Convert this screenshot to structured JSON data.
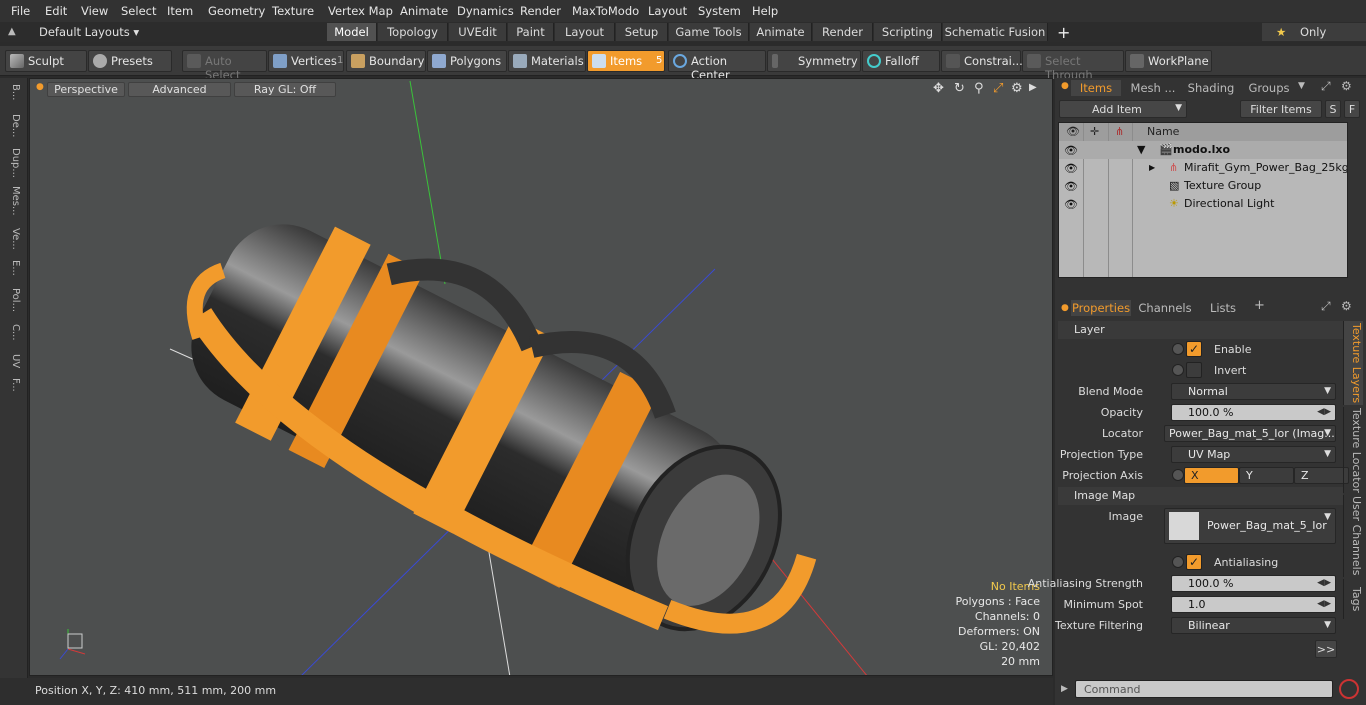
{
  "menu": [
    "File",
    "Edit",
    "View",
    "Select",
    "Item",
    "Geometry",
    "Texture",
    "Vertex Map",
    "Animate",
    "Dynamics",
    "Render",
    "MaxToModo",
    "Layout",
    "System",
    "Help"
  ],
  "layouts": {
    "default": "Default Layouts ▾",
    "only": "Only"
  },
  "layout_tabs": [
    "Model",
    "Topology",
    "UVEdit",
    "Paint",
    "Layout",
    "Setup",
    "Game Tools",
    "Animate",
    "Render",
    "Scripting",
    "Schematic Fusion"
  ],
  "toolbar": {
    "sculpt": "Sculpt",
    "presets": "Presets",
    "auto_select": "Auto Select",
    "vertices": "Vertices",
    "vertices_count": "1",
    "boundary": "Boundary",
    "polygons": "Polygons",
    "materials": "Materials",
    "items": "Items",
    "items_count": "5",
    "action_center": "Action Center",
    "symmetry": "Symmetry",
    "falloff": "Falloff",
    "constraints": "Constrai...",
    "select_through": "Select Through",
    "workplane": "WorkPlane"
  },
  "left_tabs": [
    "B...",
    "De...",
    "Dup...",
    "Mes...",
    "Ve...",
    "E...",
    "Pol...",
    "C...",
    "UV",
    "F..."
  ],
  "viewport": {
    "view": "Perspective",
    "shading": "Advanced",
    "raygl": "Ray GL: Off",
    "hud": {
      "no_items": "No Items",
      "polygons": "Polygons : Face",
      "channels": "Channels: 0",
      "deformers": "Deformers: ON",
      "gl": "GL: 20,402",
      "scale": "20 mm"
    }
  },
  "status": {
    "position": "Position X, Y, Z:   410 mm, 511 mm, 200 mm"
  },
  "items_panel": {
    "tabs": [
      "Items",
      "Mesh ...",
      "Shading",
      "Groups"
    ],
    "add_item": "Add Item",
    "filter": "Filter Items",
    "s": "S",
    "f": "F",
    "name_col": "Name",
    "rows": [
      "modo.lxo",
      "Mirafit_Gym_Power_Bag_25kg ...",
      "Texture Group",
      "Directional Light"
    ]
  },
  "properties": {
    "tabs": [
      "Properties",
      "Channels",
      "Lists"
    ],
    "side_tabs": [
      "Texture Layers",
      "Texture Locator",
      "User Channels",
      "Tags"
    ],
    "layer": "Layer",
    "enable": "Enable",
    "invert": "Invert",
    "blend_mode_label": "Blend Mode",
    "blend_mode": "Normal",
    "opacity_label": "Opacity",
    "opacity": "100.0 %",
    "locator_label": "Locator",
    "locator": "Power_Bag_mat_5_Ior (Imag...",
    "proj_type_label": "Projection Type",
    "proj_type": "UV Map",
    "proj_axis_label": "Projection Axis",
    "axis_x": "X",
    "axis_y": "Y",
    "axis_z": "Z",
    "image_map": "Image Map",
    "image_label": "Image",
    "image": "Power_Bag_mat_5_Ior",
    "antialiasing": "Antialiasing",
    "aa_strength_label": "Antialiasing Strength",
    "aa_strength": "100.0 %",
    "min_spot_label": "Minimum Spot",
    "min_spot": "1.0",
    "tex_filter_label": "Texture Filtering",
    "tex_filter": "Bilinear",
    "more": ">>"
  },
  "command": {
    "placeholder": "Command"
  },
  "colors": {
    "accent": "#f29b2c",
    "x_axis": "#d23a3a",
    "y_axis": "#3ac23a",
    "z_axis": "#3a4ad2"
  }
}
